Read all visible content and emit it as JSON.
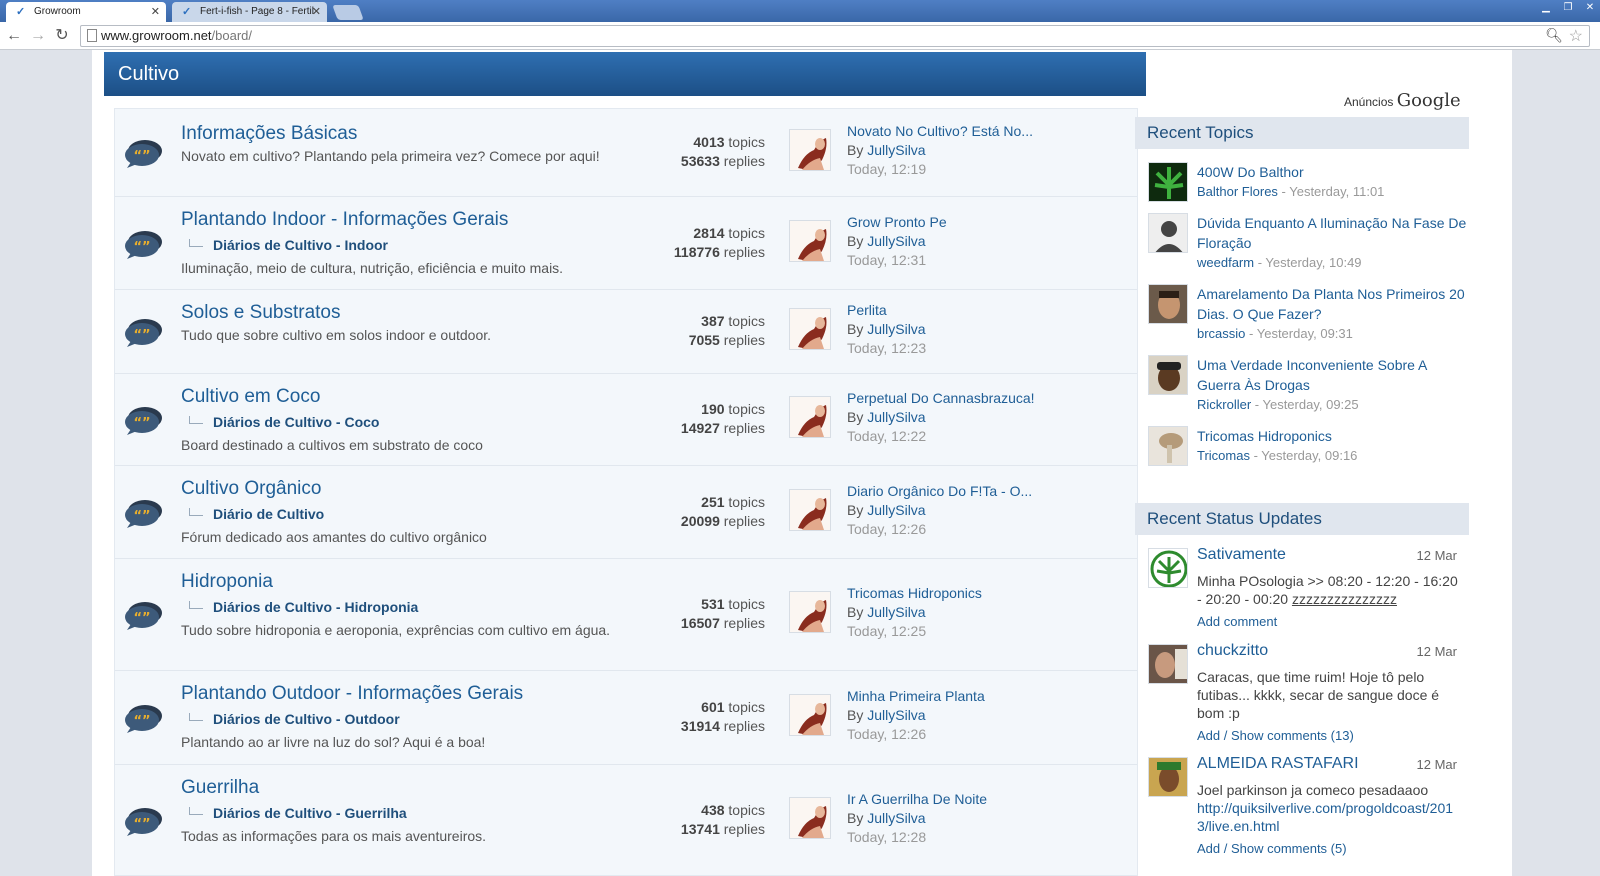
{
  "browser": {
    "tabs": [
      {
        "label": "Growroom",
        "active": true
      },
      {
        "label": "Fert-i-fish - Page 8 - Fertil",
        "active": false
      }
    ],
    "url_host": "www.growroom.net",
    "url_path": "/board/"
  },
  "section": {
    "title": "Cultivo"
  },
  "forums": [
    {
      "title": "Informações Básicas",
      "subforum": "",
      "description": "Novato em cultivo? Plantando pela primeira vez? Comece por aqui!",
      "topics": "4013",
      "replies": "53633",
      "last_title": "Novato No Cultivo? Está No...",
      "last_author": "JullySilva",
      "last_time": "Today, 12:19"
    },
    {
      "title": "Plantando Indoor - Informações Gerais",
      "subforum": "Diários de Cultivo - Indoor",
      "description": "Iluminação, meio de cultura, nutrição, eficiência e muito mais.",
      "topics": "2814",
      "replies": "118776",
      "last_title": "Grow Pronto Pe",
      "last_author": "JullySilva",
      "last_time": "Today, 12:31"
    },
    {
      "title": "Solos e Substratos",
      "subforum": "",
      "description": "Tudo que sobre cultivo em solos indoor e outdoor.",
      "topics": "387",
      "replies": "7055",
      "last_title": "Perlita",
      "last_author": "JullySilva",
      "last_time": "Today, 12:23"
    },
    {
      "title": "Cultivo em Coco",
      "subforum": "Diários de Cultivo - Coco",
      "description": "Board destinado a cultivos em substrato de coco",
      "topics": "190",
      "replies": "14927",
      "last_title": "Perpetual Do Cannasbrazuca!",
      "last_author": "JullySilva",
      "last_time": "Today, 12:22"
    },
    {
      "title": "Cultivo Orgânico",
      "subforum": "Diário de Cultivo",
      "description": "Fórum dedicado aos amantes do cultivo orgânico",
      "topics": "251",
      "replies": "20099",
      "last_title": "Diario Orgânico Do F!Ta - O...",
      "last_author": "JullySilva",
      "last_time": "Today, 12:26"
    },
    {
      "title": "Hidroponia",
      "subforum": "Diários de Cultivo - Hidroponia",
      "description": "Tudo sobre hidroponia e aeroponia, exprências com cultivo em água.",
      "topics": "531",
      "replies": "16507",
      "last_title": "Tricomas Hidroponics",
      "last_author": "JullySilva",
      "last_time": "Today, 12:25"
    },
    {
      "title": "Plantando Outdoor - Informações Gerais",
      "subforum": "Diários de Cultivo - Outdoor",
      "description": "Plantando ao ar livre na luz do sol? Aqui é a boa!",
      "topics": "601",
      "replies": "31914",
      "last_title": "Minha Primeira Planta",
      "last_author": "JullySilva",
      "last_time": "Today, 12:26"
    },
    {
      "title": "Guerrilha",
      "subforum": "Diários de Cultivo - Guerrilha",
      "description": "Todas as informações para os mais aventureiros.",
      "topics": "438",
      "replies": "13741",
      "last_title": "Ir A Guerrilha De Noite",
      "last_author": "JullySilva",
      "last_time": "Today, 12:28"
    }
  ],
  "labels": {
    "topics": "topics",
    "replies": "replies",
    "by": "By"
  },
  "ads": {
    "label": "Anúncios",
    "brand": "Google"
  },
  "recent_topics": {
    "header": "Recent Topics",
    "items": [
      {
        "title": "400W Do Balthor",
        "author": "Balthor Flores",
        "time": " - Yesterday, 11:01"
      },
      {
        "title": "Dúvida Enquanto A Iluminação Na Fase De Floração",
        "author": "weedfarm",
        "time": " - Yesterday, 10:49"
      },
      {
        "title": "Amarelamento Da Planta Nos Primeiros 20 Dias. O Que Fazer?",
        "author": "brcassio",
        "time": " - Yesterday, 09:31"
      },
      {
        "title": "Uma Verdade Inconveniente Sobre A Guerra Às Drogas",
        "author": "Rickroller",
        "time": " - Yesterday, 09:25"
      },
      {
        "title": "Tricomas Hidroponics",
        "author": "Tricomas",
        "time": " - Yesterday, 09:16"
      }
    ]
  },
  "status_updates": {
    "header": "Recent Status Updates",
    "items": [
      {
        "name": "Sativamente",
        "date": "12 Mar",
        "text": "Minha POsologia >> 08:20 - 12:20 - 16:20 - 20:20 - 00:20 ",
        "text_underlined": "zzzzzzzzzzzzzzz",
        "link": "",
        "actions": "Add comment"
      },
      {
        "name": "chuckzitto",
        "date": "12 Mar",
        "text": "Caracas, que time ruim! Hoje tô pelo futibas... kkkk, secar de sangue doce é bom :p",
        "text_underlined": "",
        "link": "",
        "actions": "Add / Show comments (13)"
      },
      {
        "name": "ALMEIDA RASTAFARI",
        "date": "12 Mar",
        "text": "Joel parkinson ja comeco pesadaaoo ",
        "text_underlined": "",
        "link": "http://quiksilverlive.com/progoldcoast/2013/live.en.html",
        "actions": "Add / Show comments (5)"
      }
    ]
  },
  "colors": {
    "header_blue": "#1f5e96",
    "panel_bg": "#f3f7fb",
    "side_header_bg": "#e0e6ee"
  }
}
